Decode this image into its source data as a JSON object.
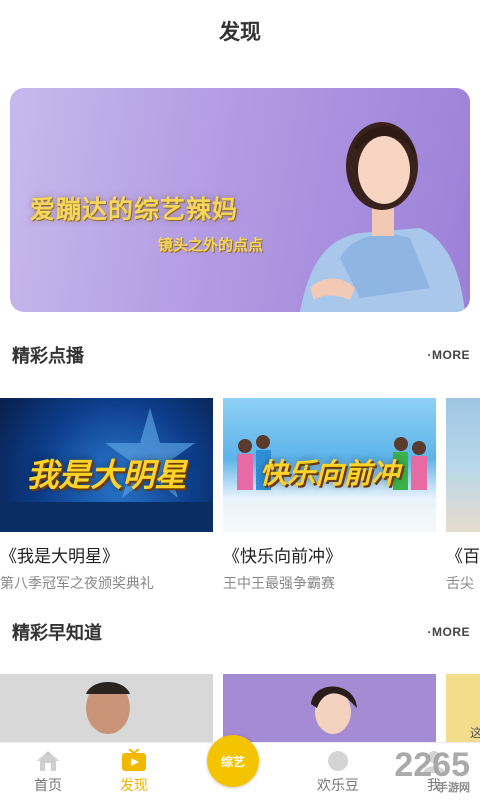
{
  "header": {
    "title": "发现"
  },
  "banner": {
    "headline": "爱蹦达的综艺辣妈",
    "subline": "镜头之外的点点"
  },
  "section1": {
    "title": "精彩点播",
    "more": "·MORE",
    "cards": [
      {
        "title": "《我是大明星》",
        "subtitle": "第八季冠军之夜颁奖典礼",
        "logo": "我是大明星"
      },
      {
        "title": "《快乐向前冲》",
        "subtitle": "王中王最强争霸赛",
        "logo": "快乐向前冲"
      },
      {
        "title": "《百",
        "subtitle": "舌尖"
      }
    ]
  },
  "section2": {
    "title": "精彩早知道",
    "more": "·MORE",
    "card3_text": "这"
  },
  "tabbar": {
    "items": [
      {
        "label": "首页",
        "icon": "home-icon"
      },
      {
        "label": "发现",
        "icon": "tv-icon"
      },
      {
        "label": "综艺",
        "icon": "center-logo-icon"
      },
      {
        "label": "欢乐豆",
        "icon": "bean-icon"
      },
      {
        "label": "我",
        "icon": "user-icon"
      }
    ],
    "active_color": "#f0b400"
  },
  "watermark": {
    "main": "2265",
    "sub": "手游网"
  }
}
